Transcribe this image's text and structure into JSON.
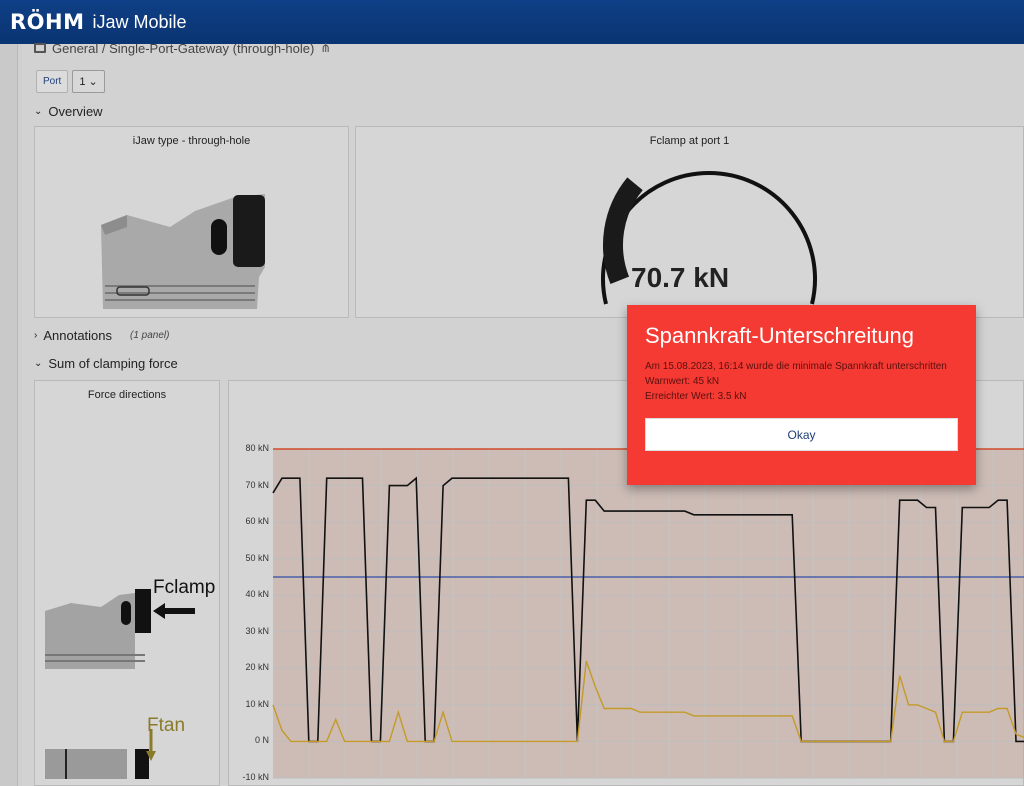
{
  "app": {
    "brand": "RÖHM",
    "title": "iJaw Mobile"
  },
  "breadcrumb": {
    "text": "General / Single-Port-Gateway (through-hole)"
  },
  "port": {
    "label": "Port",
    "value": "1 ⌄"
  },
  "sections": {
    "overview": "Overview",
    "annotations": "Annotations",
    "annotations_sub": "(1 panel)",
    "sum": "Sum of clamping force"
  },
  "panels": {
    "ijaw_type": "iJaw type - through-hole",
    "fclamp_port": "Fclamp at port 1",
    "gauge_value": "70.7 kN",
    "force_directions": "Force directions",
    "fclamp_label": "Fclamp",
    "ftan_label": "Ftan"
  },
  "modal": {
    "title": "Spannkraft-Unterschreitung",
    "line1": "Am 15.08.2023, 16:14 wurde die minimale Spannkraft unterschritten",
    "line2": "Warnwert: 45 kN",
    "line3": "Erreichter Wert: 3.5 kN",
    "button": "Okay"
  },
  "colors": {
    "header": "#0a3472",
    "modal": "#f43a32",
    "threshold_red": "#d24a2a",
    "threshold_blue": "#4a5fa8",
    "series_black": "#111111",
    "series_gold": "#c49a28"
  },
  "chart_data": {
    "type": "line",
    "yunit": "kN",
    "ylim": [
      -10,
      80
    ],
    "yticks": [
      "80 kN",
      "70 kN",
      "60 kN",
      "50 kN",
      "40 kN",
      "30 kN",
      "20 kN",
      "10 kN",
      "0 N",
      "-10 kN"
    ],
    "thresholds": [
      {
        "value": 80,
        "color": "#d24a2a"
      },
      {
        "value": 45,
        "color": "#4a5fa8"
      }
    ],
    "series": [
      {
        "values": [
          68,
          72,
          72,
          72,
          0,
          0,
          72,
          72,
          72,
          72,
          72,
          0,
          0,
          70,
          70,
          70,
          72,
          0,
          0,
          70,
          72,
          72,
          72,
          72,
          72,
          72,
          72,
          72,
          72,
          72,
          72,
          72,
          72,
          72,
          0,
          66,
          66,
          63,
          63,
          63,
          63,
          63,
          63,
          63,
          63,
          63,
          63,
          62,
          62,
          62,
          62,
          62,
          62,
          62,
          62,
          62,
          62,
          62,
          62,
          0,
          0,
          0,
          0,
          0,
          0,
          0,
          0,
          0,
          0,
          0,
          66,
          66,
          66,
          64,
          64,
          0,
          0,
          64,
          64,
          64,
          64,
          66,
          66,
          0,
          0
        ]
      },
      {
        "values": [
          10,
          3,
          0,
          0,
          0,
          0,
          0,
          6,
          0,
          0,
          0,
          0,
          0,
          0,
          8,
          0,
          0,
          0,
          0,
          8,
          0,
          0,
          0,
          0,
          0,
          0,
          0,
          0,
          0,
          0,
          0,
          0,
          0,
          0,
          0,
          22,
          15,
          9,
          9,
          9,
          9,
          8,
          8,
          8,
          8,
          8,
          8,
          7,
          7,
          7,
          7,
          7,
          7,
          7,
          7,
          7,
          7,
          7,
          7,
          0,
          0,
          0,
          0,
          0,
          0,
          0,
          0,
          0,
          0,
          0,
          18,
          10,
          10,
          9,
          8,
          0,
          0,
          8,
          8,
          8,
          8,
          9,
          9,
          2,
          1
        ]
      }
    ]
  }
}
